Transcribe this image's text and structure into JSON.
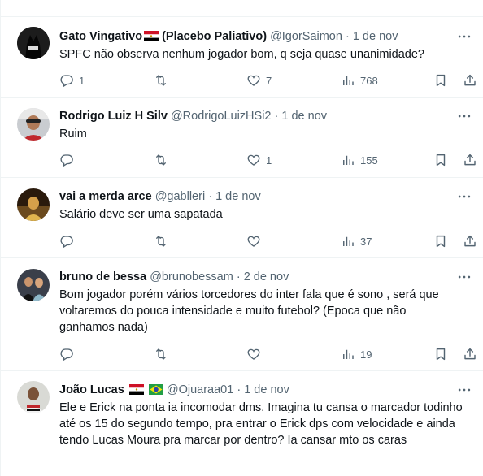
{
  "tweets": [
    {
      "name": "Gato Vingativo",
      "name_suffix": "(Placebo Paliativo)",
      "handle": "@IgorSaimon",
      "dot": "·",
      "date": "1 de nov",
      "text": "SPFC não observa nenhum jogador bom, q seja quase unanimidade?",
      "replies": "1",
      "retweets": "",
      "likes": "7",
      "views": "768"
    },
    {
      "name": "Rodrigo Luiz H Silv",
      "handle": "@RodrigoLuizHSi2",
      "dot": "·",
      "date": "1 de nov",
      "text": "Ruim",
      "replies": "",
      "retweets": "",
      "likes": "1",
      "views": "155"
    },
    {
      "name": "vai a merda arce",
      "handle": "@gablleri",
      "dot": "·",
      "date": "1 de nov",
      "text": "Salário deve ser uma sapatada",
      "replies": "",
      "retweets": "",
      "likes": "",
      "views": "37"
    },
    {
      "name": "bruno de bessa",
      "handle": "@brunobessam",
      "dot": "·",
      "date": "2 de nov",
      "text": "Bom jogador porém vários torcedores do inter fala que é sono , será que voltaremos do pouca intensidade e muito futebol? (Epoca que não ganhamos nada)",
      "replies": "",
      "retweets": "",
      "likes": "",
      "views": "19"
    },
    {
      "name": "João Lucas",
      "handle": "@Ojuaraa01",
      "dot": "·",
      "date": "1 de nov",
      "text": "Ele e Erick na ponta ia incomodar dms. Imagina tu cansa o marcador todinho até os 15 do segundo tempo, pra entrar o Erick dps com velocidade e ainda tendo Lucas Moura pra marcar por dentro? Ia cansar mto os caras"
    }
  ],
  "icons": {
    "more": "more-horizontal-icon",
    "reply": "reply-icon",
    "retweet": "retweet-icon",
    "like": "heart-icon",
    "views": "views-chart-icon",
    "bookmark": "bookmark-icon",
    "share": "share-icon"
  },
  "colors": {
    "text": "#0f1419",
    "secondary": "#536471",
    "divider": "#eff3f4"
  }
}
